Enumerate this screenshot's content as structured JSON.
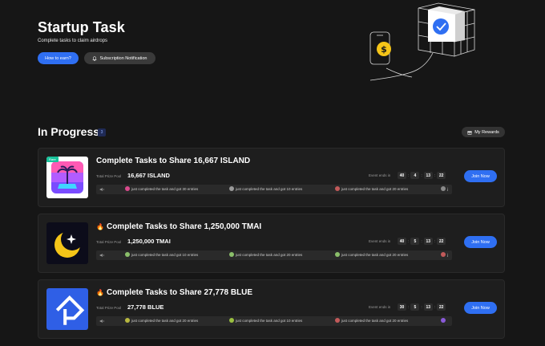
{
  "hero": {
    "title": "Startup Task",
    "subtitle": "Complete tasks to claim airdrops",
    "earn_button": "How to earn?",
    "subscription_button": "Subscription Notification"
  },
  "section": {
    "title": "In Progress",
    "count": "3",
    "rewards_button": "My Rewards"
  },
  "cards": [
    {
      "badge": "Rare",
      "title": "Complete Tasks to Share 16,667 ISLAND",
      "pool_label": "Total Prize Pool",
      "pool_value": "16,667 ISLAND",
      "ends_label": "Event ends in",
      "timer": [
        "40",
        "4",
        "13",
        "22"
      ],
      "join": "Join Now",
      "feed": [
        "just completed the task and got 30 entries",
        "just completed the task and got 10 entries",
        "just completed the task and got 20 entries"
      ],
      "hot": false
    },
    {
      "title": "Complete Tasks to Share 1,250,000 TMAI",
      "pool_label": "Total Prize Pool",
      "pool_value": "1,250,000 TMAI",
      "ends_label": "Event ends in",
      "timer": [
        "40",
        "5",
        "13",
        "22"
      ],
      "join": "Join Now",
      "feed": [
        "just completed the task and got 10 entries",
        "just completed the task and got 20 entries",
        "just completed the task and got 20 entries"
      ],
      "hot": true
    },
    {
      "title": "Complete Tasks to Share 27,778 BLUE",
      "pool_label": "Total Prize Pool",
      "pool_value": "27,778 BLUE",
      "ends_label": "Event ends in",
      "timer": [
        "30",
        "5",
        "13",
        "22"
      ],
      "join": "Join Now",
      "feed": [
        "just completed the task and got 20 entries",
        "just completed the task and got 10 entries",
        "just completed the task and got 20 entries"
      ],
      "hot": true
    }
  ],
  "colors": {
    "accent": "#2f6ff2",
    "background": "#161616",
    "card": "#1e1e1e",
    "fire": "#ff5a2e"
  }
}
